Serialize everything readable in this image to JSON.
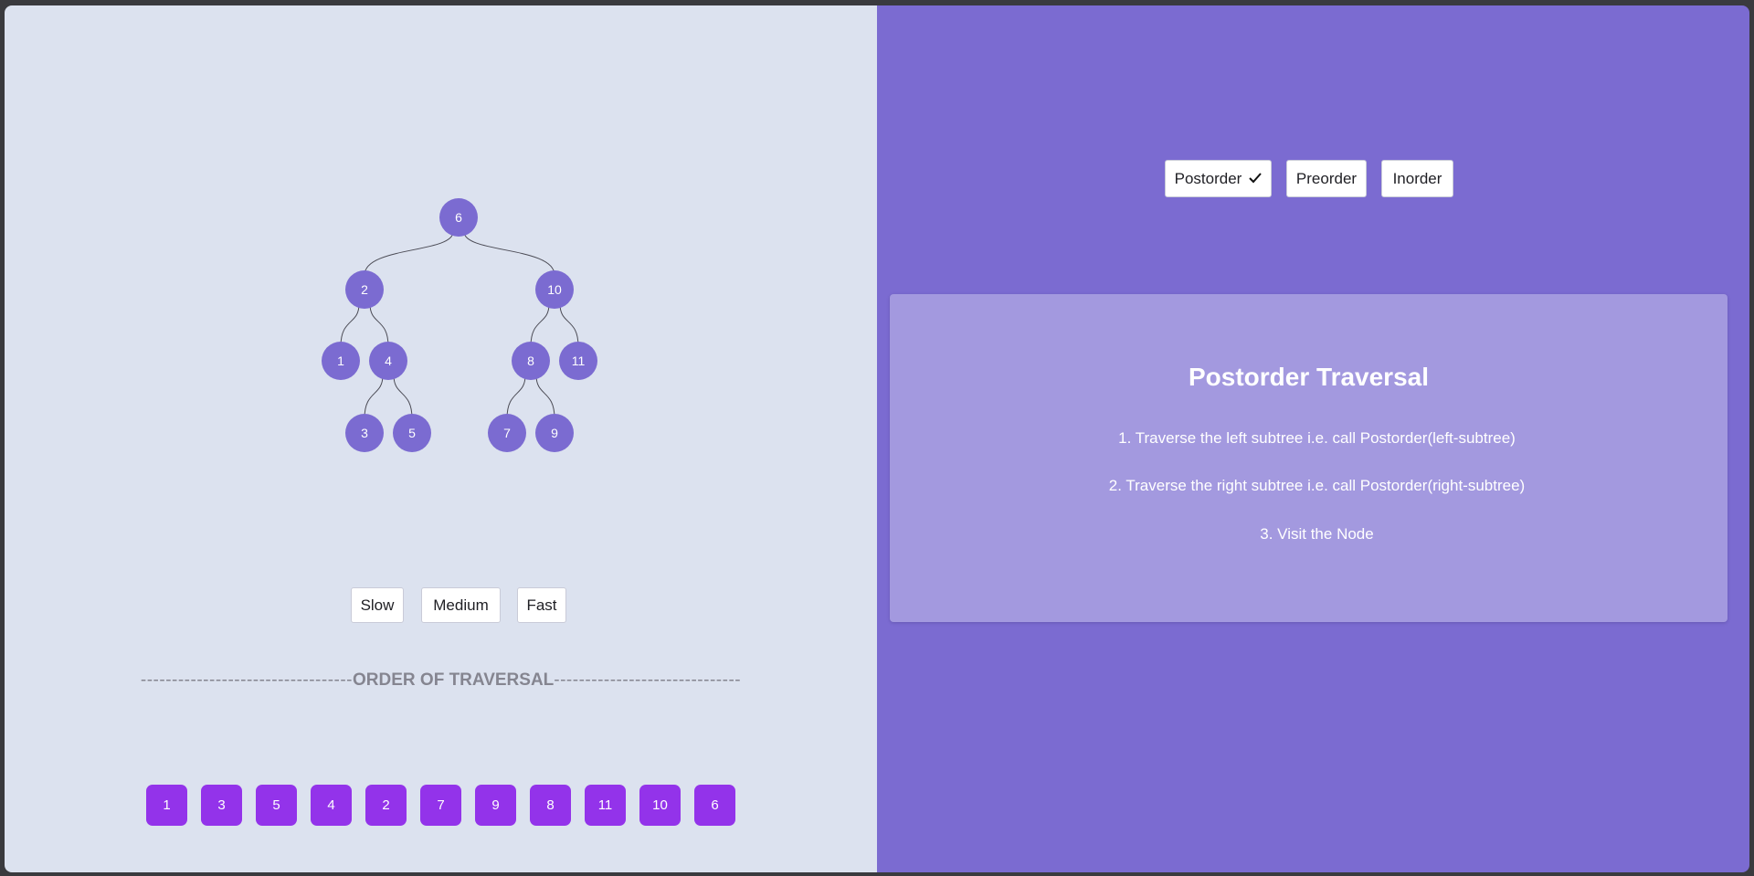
{
  "tree": {
    "nodes": [
      {
        "id": "6",
        "label": "6"
      },
      {
        "id": "2",
        "label": "2"
      },
      {
        "id": "10",
        "label": "10"
      },
      {
        "id": "1",
        "label": "1"
      },
      {
        "id": "4",
        "label": "4"
      },
      {
        "id": "8",
        "label": "8"
      },
      {
        "id": "11",
        "label": "11"
      },
      {
        "id": "3",
        "label": "3"
      },
      {
        "id": "5",
        "label": "5"
      },
      {
        "id": "7",
        "label": "7"
      },
      {
        "id": "9",
        "label": "9"
      }
    ],
    "edges": [
      [
        "6",
        "2"
      ],
      [
        "6",
        "10"
      ],
      [
        "2",
        "1"
      ],
      [
        "2",
        "4"
      ],
      [
        "10",
        "8"
      ],
      [
        "10",
        "11"
      ],
      [
        "4",
        "3"
      ],
      [
        "4",
        "5"
      ],
      [
        "8",
        "7"
      ],
      [
        "8",
        "9"
      ]
    ]
  },
  "speed": {
    "slow_label": "Slow",
    "medium_label": "Medium",
    "fast_label": "Fast"
  },
  "order": {
    "dashes_left": "----------------------------------",
    "heading": "ORDER OF TRAVERSAL",
    "dashes_right": "------------------------------",
    "sequence": [
      "1",
      "3",
      "5",
      "4",
      "2",
      "7",
      "9",
      "8",
      "11",
      "10",
      "6"
    ]
  },
  "traversal_tabs": {
    "postorder_label": "Postorder",
    "preorder_label": "Preorder",
    "inorder_label": "Inorder",
    "selected": "Postorder"
  },
  "info": {
    "title": "Postorder Traversal",
    "steps": [
      "1. Traverse the left subtree i.e. call Postorder(left-subtree)",
      "2. Traverse the right subtree i.e. call Postorder(right-subtree)",
      "3. Visit the Node"
    ]
  },
  "colors": {
    "node": "#7b6bd1",
    "order_box": "#9333ea",
    "left_bg": "#dce2ef",
    "right_bg": "#7b6bd1"
  }
}
